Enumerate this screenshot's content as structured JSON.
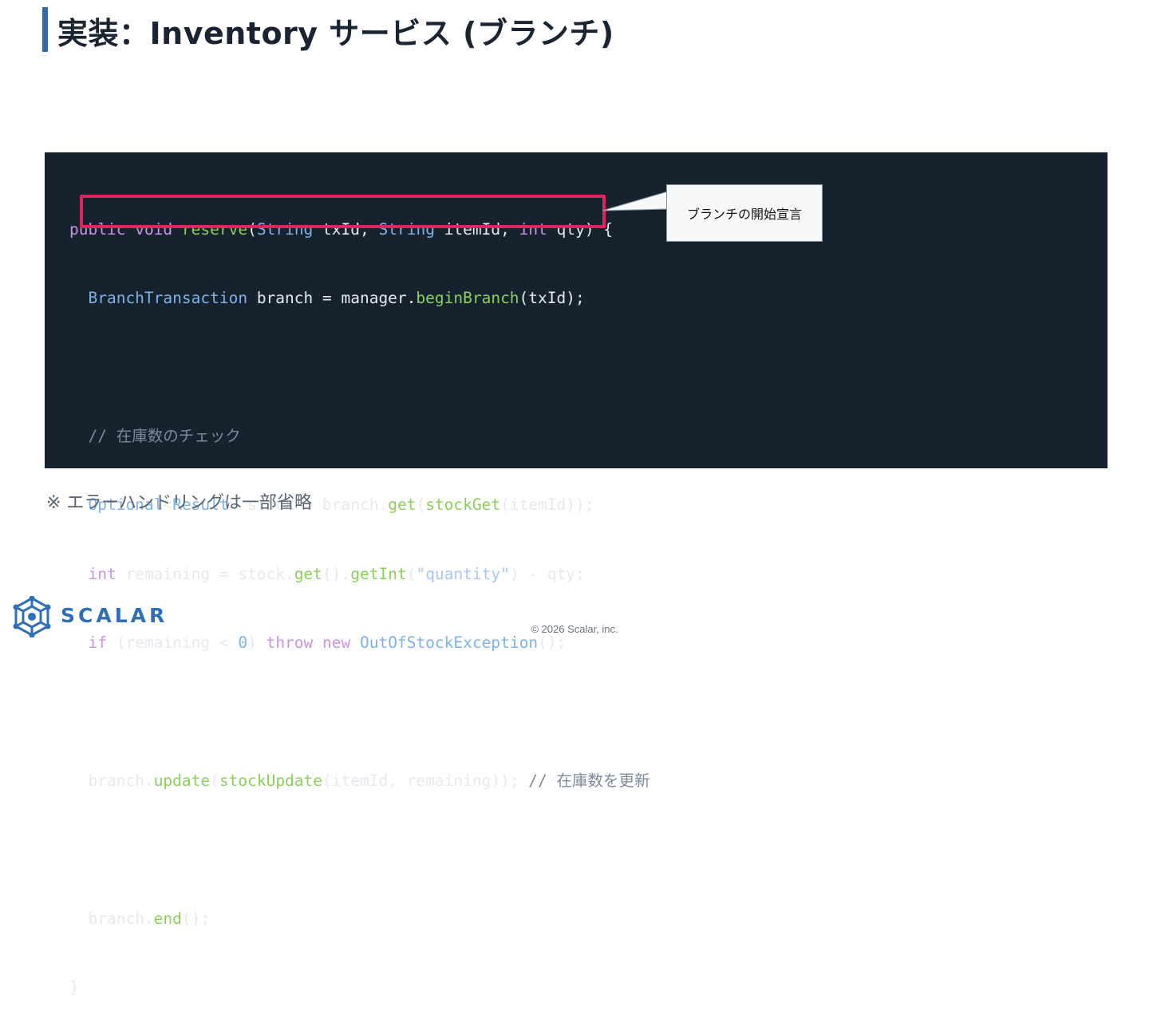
{
  "slide": {
    "title": "実装：Inventory サービス (ブランチ)",
    "note": "※ エラーハンドリングは一部省略",
    "callout": "ブランチの開始宣言",
    "copyright": "© 2026 Scalar, inc."
  },
  "brand": {
    "name": "SCALAR",
    "accent_color": "#2f6fb8",
    "logo_icon": "scalar-logo-icon"
  },
  "code": {
    "line1": {
      "t1": "public",
      "t2": " ",
      "t3": "void",
      "t4": " ",
      "t5": "reserve",
      "t6": "(",
      "t7": "String",
      "t8": " txId, ",
      "t9": "String",
      "t10": " itemId, ",
      "t11": "int",
      "t12": " qty) {"
    },
    "line2": {
      "t1": "  ",
      "t2": "BranchTransaction",
      "t3": " branch = manager.",
      "t4": "beginBranch",
      "t5": "(txId);"
    },
    "line3": {
      "t1": ""
    },
    "line4": {
      "t1": "  ",
      "t2": "// 在庫数のチェック"
    },
    "line5": {
      "t1": "  ",
      "t2": "Optional",
      "t3": "<",
      "t4": "Result",
      "t5": "> stock = branch.",
      "t6": "get",
      "t7": "(",
      "t8": "stockGet",
      "t9": "(itemId));"
    },
    "line6": {
      "t1": "  ",
      "t2": "int",
      "t3": " remaining = stock.",
      "t4": "get",
      "t5": "().",
      "t6": "getInt",
      "t7": "(",
      "t8": "\"quantity\"",
      "t9": ") - qty;"
    },
    "line7": {
      "t1": "  ",
      "t2": "if",
      "t3": " (remaining < ",
      "t4": "0",
      "t5": ") ",
      "t6": "throw",
      "t7": " ",
      "t8": "new",
      "t9": " ",
      "t10": "OutOfStockException",
      "t11": "();"
    },
    "line8": {
      "t1": ""
    },
    "line9": {
      "t1": "  branch.",
      "t2": "update",
      "t3": "(",
      "t4": "stockUpdate",
      "t5": "(itemId, remaining)); ",
      "t6": "// 在庫数を更新"
    },
    "line10": {
      "t1": ""
    },
    "line11": {
      "t1": "  branch.",
      "t2": "end",
      "t3": "();"
    },
    "line12": {
      "t1": "}"
    }
  }
}
